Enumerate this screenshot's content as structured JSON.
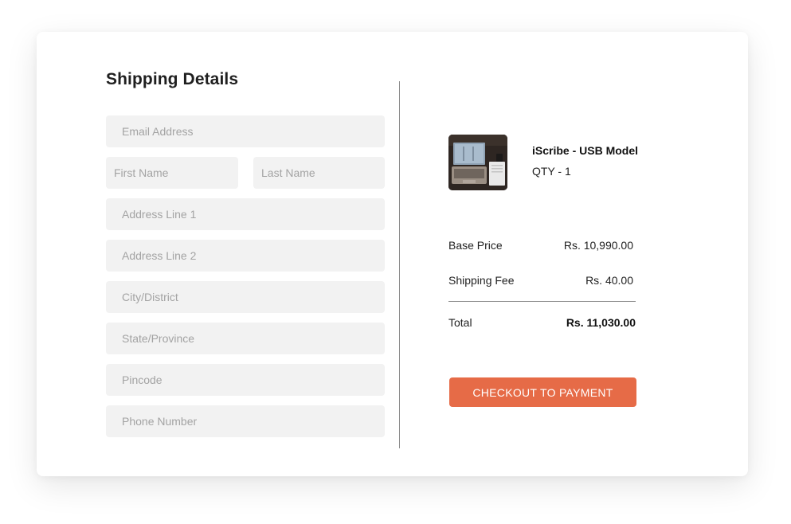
{
  "form": {
    "title": "Shipping Details",
    "email_placeholder": "Email Address",
    "first_name_placeholder": "First Name",
    "last_name_placeholder": "Last Name",
    "address1_placeholder": "Address Line 1",
    "address2_placeholder": "Address Line 2",
    "city_placeholder": "City/District",
    "state_placeholder": "State/Province",
    "pincode_placeholder": "Pincode",
    "phone_placeholder": "Phone Number"
  },
  "order": {
    "product_name": "iScribe - USB Model",
    "quantity": "QTY - 1",
    "base_price_label": "Base Price",
    "base_price_value": "Rs. 10,990.00",
    "shipping_label": "Shipping Fee",
    "shipping_value": "Rs. 40.00",
    "total_label": "Total",
    "total_value": "Rs. 11,030.00",
    "checkout_label": "CHECKOUT TO PAYMENT"
  },
  "colors": {
    "accent": "#e66b47",
    "field_bg": "#f2f2f2",
    "divider": "#8c8c8c"
  }
}
